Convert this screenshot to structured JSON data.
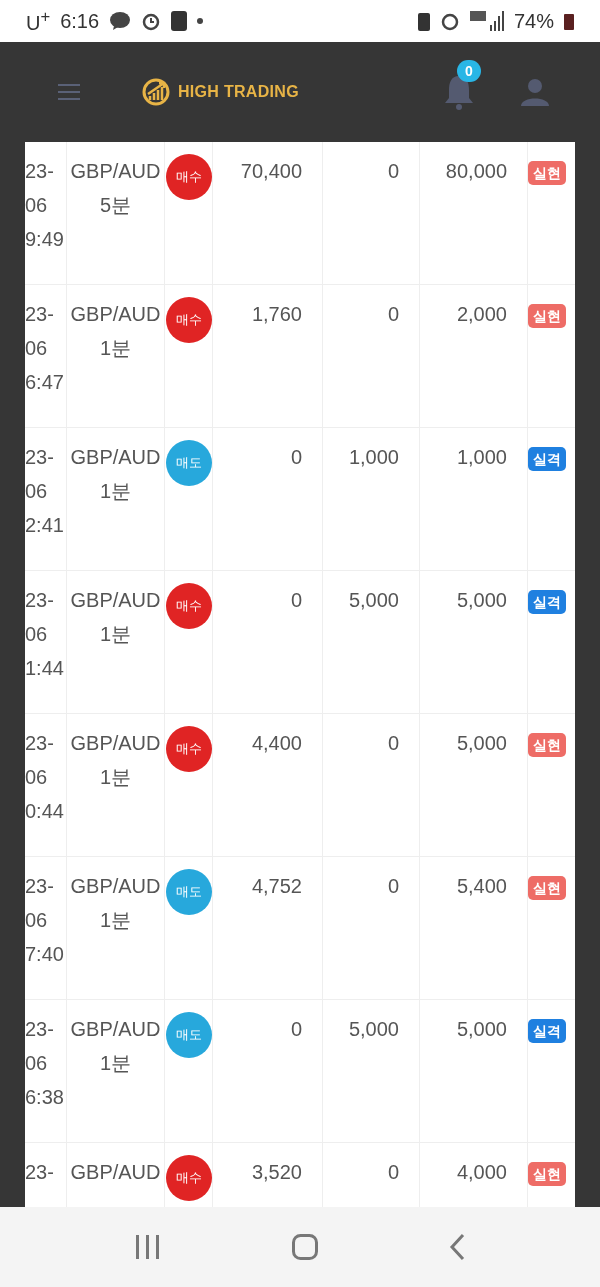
{
  "status_bar": {
    "carrier": "U$^{+}$",
    "time": "6:16",
    "battery": "74%"
  },
  "header": {
    "brand": "HIGH TRADING",
    "notification_count": "0"
  },
  "rows": [
    {
      "date_lines": [
        "23-",
        "06",
        "9:49"
      ],
      "symbol": "GBP/AUD",
      "interval": "5분",
      "side": {
        "label": "매수",
        "kind": "buy"
      },
      "column_4": "70,400",
      "column_5": "0",
      "column_6": "80,000",
      "status": {
        "label": "실현",
        "kind": "realized"
      }
    },
    {
      "date_lines": [
        "23-",
        "06",
        "6:47"
      ],
      "symbol": "GBP/AUD",
      "interval": "1분",
      "side": {
        "label": "매수",
        "kind": "buy"
      },
      "column_4": "1,760",
      "column_5": "0",
      "column_6": "2,000",
      "status": {
        "label": "실현",
        "kind": "realized"
      }
    },
    {
      "date_lines": [
        "23-",
        "06",
        "2:41"
      ],
      "symbol": "GBP/AUD",
      "interval": "1분",
      "side": {
        "label": "매도",
        "kind": "sell"
      },
      "column_4": "0",
      "column_5": "1,000",
      "column_6": "1,000",
      "status": {
        "label": "실격",
        "kind": "lost"
      }
    },
    {
      "date_lines": [
        "23-",
        "06",
        "1:44"
      ],
      "symbol": "GBP/AUD",
      "interval": "1분",
      "side": {
        "label": "매수",
        "kind": "buy"
      },
      "column_4": "0",
      "column_5": "5,000",
      "column_6": "5,000",
      "status": {
        "label": "실격",
        "kind": "lost"
      }
    },
    {
      "date_lines": [
        "23-",
        "06",
        "0:44"
      ],
      "symbol": "GBP/AUD",
      "interval": "1분",
      "side": {
        "label": "매수",
        "kind": "buy"
      },
      "column_4": "4,400",
      "column_5": "0",
      "column_6": "5,000",
      "status": {
        "label": "실현",
        "kind": "realized"
      }
    },
    {
      "date_lines": [
        "23-",
        "06",
        "7:40"
      ],
      "symbol": "GBP/AUD",
      "interval": "1분",
      "side": {
        "label": "매도",
        "kind": "sell"
      },
      "column_4": "4,752",
      "column_5": "0",
      "column_6": "5,400",
      "status": {
        "label": "실현",
        "kind": "realized"
      }
    },
    {
      "date_lines": [
        "23-",
        "06",
        "6:38"
      ],
      "symbol": "GBP/AUD",
      "interval": "1분",
      "side": {
        "label": "매도",
        "kind": "sell"
      },
      "column_4": "0",
      "column_5": "5,000",
      "column_6": "5,000",
      "status": {
        "label": "실격",
        "kind": "lost"
      }
    },
    {
      "date_lines": [
        "23-"
      ],
      "symbol": "GBP/AUD",
      "side": {
        "label": "매수",
        "kind": "buy"
      },
      "column_4": "3,520",
      "column_5": "0",
      "column_6": "4,000",
      "status": {
        "label": "실현",
        "kind": "realized"
      }
    }
  ]
}
